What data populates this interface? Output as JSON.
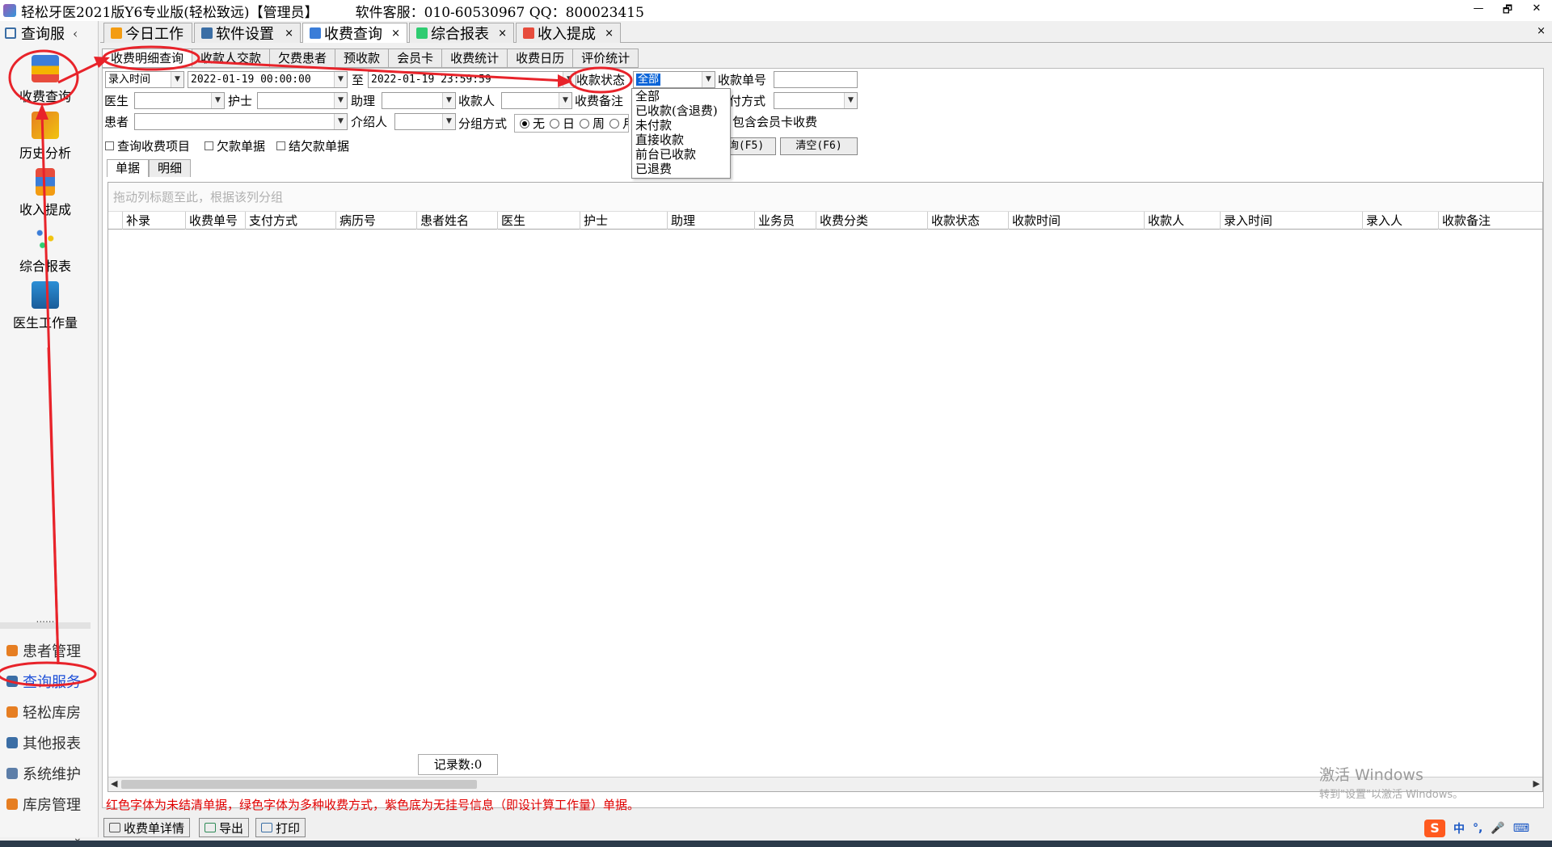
{
  "window": {
    "title": "轻松牙医2021版Y6专业版(轻松致远)【管理员】",
    "support": "软件客服：010-60530967 QQ：800023415",
    "controls": [
      "—",
      "🗗",
      "✕"
    ]
  },
  "leftpanel": {
    "header": "查询服",
    "header_chevron": "‹",
    "modules": [
      {
        "label": "收费查询",
        "icon": "chart-search-icon"
      },
      {
        "label": "历史分析",
        "icon": "history-analysis-icon"
      },
      {
        "label": "收入提成",
        "icon": "income-bar-icon"
      },
      {
        "label": "综合报表",
        "icon": "report-dots-icon"
      },
      {
        "label": "医生工作量",
        "icon": "doctor-icon"
      }
    ],
    "separator": "......",
    "nav": [
      {
        "label": "患者管理",
        "icon": "patients-icon",
        "color": "#e67e22"
      },
      {
        "label": "查询服务",
        "icon": "query-icon",
        "color": "#3b6ea5"
      },
      {
        "label": "轻松库房",
        "icon": "warehouse-icon",
        "color": "#e67e22"
      },
      {
        "label": "其他报表",
        "icon": "other-report-icon",
        "color": "#3b6ea5"
      },
      {
        "label": "系统维护",
        "icon": "maintenance-icon",
        "color": "#3b6ea5"
      },
      {
        "label": "库房管理",
        "icon": "store-manage-icon",
        "color": "#e67e22"
      }
    ],
    "more": "⌄"
  },
  "maintabs": [
    {
      "label": "今日工作",
      "close": ""
    },
    {
      "label": "软件设置",
      "close": "×"
    },
    {
      "label": "收费查询",
      "close": "×"
    },
    {
      "label": "综合报表",
      "close": "×"
    },
    {
      "label": "收入提成",
      "close": "×"
    }
  ],
  "main_close": "×",
  "subtabs": [
    "收费明细查询",
    "收款人交款",
    "欠费患者",
    "预收款",
    "会员卡",
    "收费统计",
    "收费日历",
    "评价统计"
  ],
  "filters": {
    "time_type": "录入时间",
    "start": "2022-01-19 00:00:00",
    "to": "至",
    "end": "2022-01-19 23:59:59",
    "status_label": "收款状态",
    "status_value": "全部",
    "receipt_no_label": "收款单号",
    "doctor_label": "医生",
    "nurse_label": "护士",
    "assistant_label": "助理",
    "cashier_label": "收款人",
    "remark_label": "收费备注",
    "pay_label": "付方式",
    "patient_label": "患者",
    "introducer_label": "介绍人",
    "group_label": "分组方式",
    "member_checkbox": "包含会员卡收费",
    "group_options": [
      "无",
      "日",
      "周",
      "月"
    ],
    "chk_items": "查询收费项目",
    "chk_debt": "欠款单据",
    "chk_settled": "结欠款单据",
    "query_btn": "询(F5)",
    "clear_btn": "清空(F6)"
  },
  "status_options": [
    "全部",
    "已收款(含退费)",
    "未付款",
    "直接收款",
    "前台已收款",
    "已退费"
  ],
  "innertabs": [
    "单据",
    "明细"
  ],
  "grid": {
    "group_hint": "拖动列标题至此，根据该列分组",
    "columns": [
      "补录",
      "收费单号",
      "支付方式",
      "病历号",
      "患者姓名",
      "医生",
      "护士",
      "助理",
      "业务员",
      "收费分类",
      "收款状态",
      "收款时间",
      "收款人",
      "录入时间",
      "录入人",
      "收款备注"
    ],
    "record_count": "记录数:0"
  },
  "legend": "红色字体为未结清单据，绿色字体为多种收费方式，紫色底为无挂号信息（即设计算工作量）单据。",
  "bottom_buttons": [
    "收费单详情",
    "导出",
    "打印"
  ],
  "watermark": {
    "line1": "激活 Windows",
    "line2": "转到\"设置\"以激活 Windows。"
  },
  "ime": {
    "logo": "S",
    "lang": "中",
    "punct": "°,"
  },
  "accent_red": "#e8232a",
  "accent_selection": "#0a64d8"
}
